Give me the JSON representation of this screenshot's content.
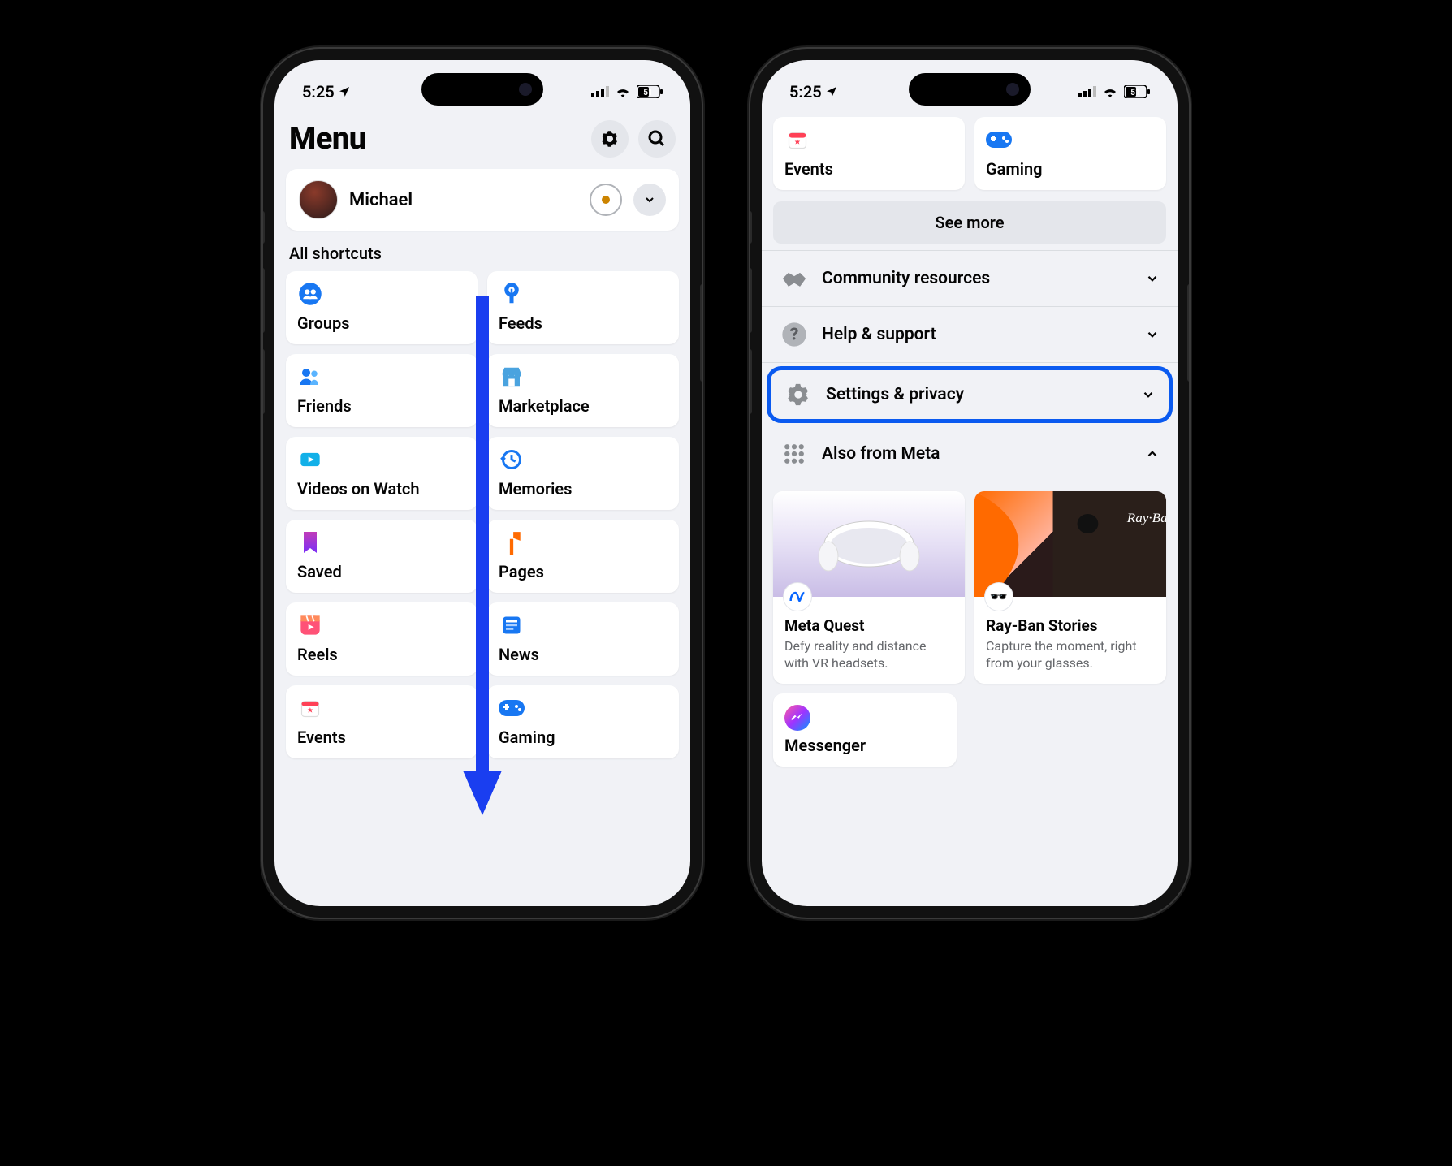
{
  "status": {
    "time": "5:25",
    "battery": "51"
  },
  "left": {
    "title": "Menu",
    "profile_name": "Michael",
    "section_label": "All shortcuts",
    "shortcuts": [
      {
        "label": "Groups",
        "icon": "groups"
      },
      {
        "label": "Feeds",
        "icon": "feeds"
      },
      {
        "label": "Friends",
        "icon": "friends"
      },
      {
        "label": "Marketplace",
        "icon": "marketplace"
      },
      {
        "label": "Videos on Watch",
        "icon": "videos"
      },
      {
        "label": "Memories",
        "icon": "memories"
      },
      {
        "label": "Saved",
        "icon": "saved"
      },
      {
        "label": "Pages",
        "icon": "pages"
      },
      {
        "label": "Reels",
        "icon": "reels"
      },
      {
        "label": "News",
        "icon": "news"
      },
      {
        "label": "Events",
        "icon": "events"
      },
      {
        "label": "Gaming",
        "icon": "gaming"
      }
    ]
  },
  "right": {
    "top_tiles": [
      {
        "label": "Events",
        "icon": "events"
      },
      {
        "label": "Gaming",
        "icon": "gaming"
      }
    ],
    "see_more": "See more",
    "rows": [
      {
        "label": "Community resources",
        "icon": "handshake",
        "expanded": false
      },
      {
        "label": "Help & support",
        "icon": "help",
        "expanded": false
      },
      {
        "label": "Settings & privacy",
        "icon": "gear",
        "expanded": false,
        "highlighted": true
      },
      {
        "label": "Also from Meta",
        "icon": "grid",
        "expanded": true
      }
    ],
    "meta_cards": [
      {
        "title": "Meta Quest",
        "desc": "Defy reality and distance with VR headsets."
      },
      {
        "title": "Ray-Ban Stories",
        "desc": "Capture the moment, right from your glasses."
      }
    ],
    "messenger": "Messenger"
  }
}
